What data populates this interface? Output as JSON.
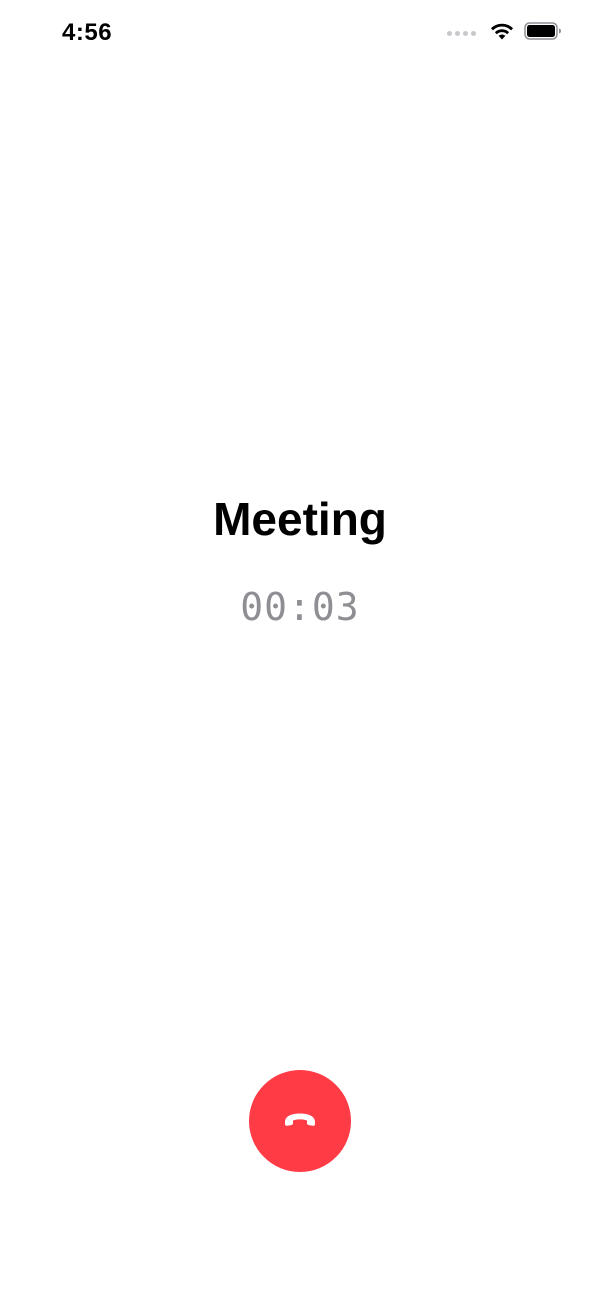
{
  "status_bar": {
    "time": "4:56",
    "signal_icon": "cellular-signal-dots-icon",
    "wifi_icon": "wifi-icon",
    "battery_icon": "battery-full-icon"
  },
  "call": {
    "title": "Meeting",
    "timer": "00:03"
  },
  "end_call_button": {
    "icon": "phone-hangup-icon",
    "color": "#ff3b45"
  }
}
